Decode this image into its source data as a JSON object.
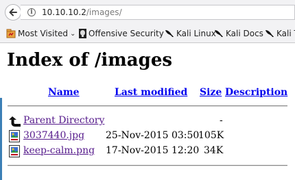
{
  "browser": {
    "url_host": "10.10.10.2",
    "url_path": "/images/"
  },
  "bookmarks": [
    {
      "label": "Most Visited",
      "icon": "most-visited-icon",
      "has_dropdown": true
    },
    {
      "label": "Offensive Security",
      "icon": "offensive-security-icon"
    },
    {
      "label": "Kali Linux",
      "icon": "kali-dragon-icon"
    },
    {
      "label": "Kali Docs",
      "icon": "kali-dragon-icon"
    },
    {
      "label": "Kali T",
      "icon": "kali-dragon-icon"
    }
  ],
  "page": {
    "title": "Index of /images",
    "columns": {
      "name": "Name",
      "last_modified": "Last modified",
      "size": "Size",
      "description": "Description"
    },
    "rows": [
      {
        "name": "Parent Directory",
        "last_modified": "",
        "size": "-",
        "icon": "parent-directory-icon"
      },
      {
        "name": "3037440.jpg",
        "last_modified": "25-Nov-2015 03:50",
        "size": "105K",
        "icon": "image-file-icon"
      },
      {
        "name": "keep-calm.png",
        "last_modified": "17-Nov-2015 12:20",
        "size": "34K",
        "icon": "image-file-icon"
      }
    ]
  },
  "colors": {
    "link": "#0000ee",
    "visited_link": "#551a8b",
    "toolbar": "#f2f2f4"
  }
}
